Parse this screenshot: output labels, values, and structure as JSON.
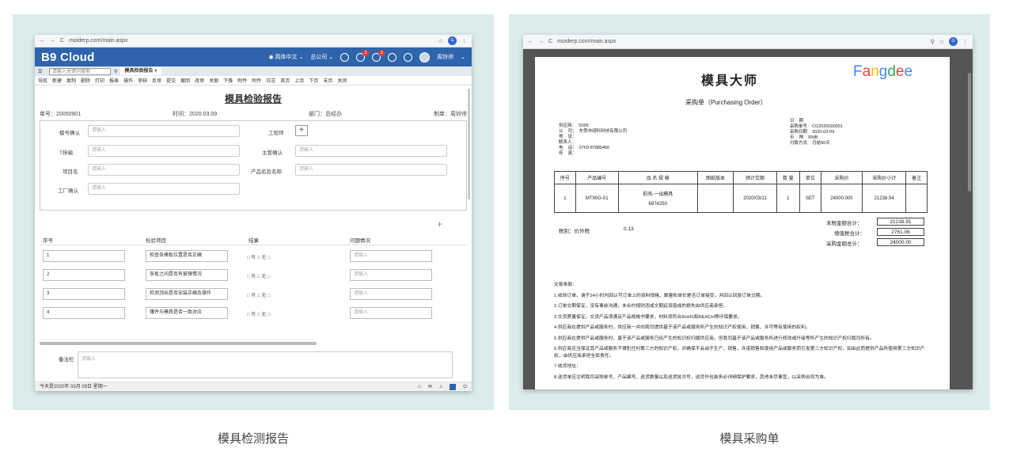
{
  "left": {
    "caption": "模具检测报告",
    "url": "moiderp.com/main.aspx",
    "avatar": "G",
    "logo": "B9 Cloud",
    "header_links": [
      "简体中文",
      "总公司"
    ],
    "user": "周铃帅",
    "badge1": "2",
    "badge2": "3",
    "search_placeholder": "请输入关键词搜索",
    "tab": "模具检验报告",
    "toolbar": [
      "导航",
      "新建",
      "复制",
      "删除",
      "打印",
      "报表",
      "操作",
      "审核",
      "反审",
      "提交",
      "撤回",
      "改审",
      "关联",
      "下推",
      "附件",
      "附件",
      "日志",
      "首页",
      "上页",
      "下页",
      "末页",
      "关闭"
    ],
    "form_title": "模具检验报告",
    "meta": {
      "no": "单号：20050901",
      "date": "时间：2020.03.09",
      "dept": "部门：总经办",
      "maker": "制单：周铃帅"
    },
    "fields": {
      "f1": "模号确认",
      "f2": "工程师",
      "f3": "T排编",
      "f4": "主管确认",
      "f5": "项目名",
      "f6": "产品名及名称",
      "f7": "工厂确认"
    },
    "ph": "请输入",
    "cols": {
      "c1": "序号",
      "c2": "检验项目",
      "c3": "结果",
      "c4": "问题情况"
    },
    "rows": [
      {
        "n": "1",
        "item": "检查各模板位置是否正确",
        "res": "□ 有  □ 无  □"
      },
      {
        "n": "2",
        "item": "各板之间是否有披锋情况",
        "res": "□ 有  □ 无  □"
      },
      {
        "n": "3",
        "item": "检测顶出是否安装正确及操作",
        "res": "□ 有  □ 无  □"
      },
      {
        "n": "4",
        "item": "镶件与模具是否一致对应",
        "res": "□ 有  □ 无  □"
      }
    ],
    "remark_label": "备注栏",
    "status": "今天是2020年 03月 09日 星期一"
  },
  "right": {
    "caption": "模具采购单",
    "url": "moiderp.com/main.aspx",
    "avatar": "G",
    "title": "模具大师",
    "brand": "Fangdee",
    "subtitle": "采购单（Purchasing Order）",
    "supplier": "供应商：  S005\n公    司：  东莞市翊科科技有限公司\n地    址：\n联系人：\n电    话：  0769-87885466\n传    真：",
    "orderinfo": "日    期\n采购单号    CG2020030001\n采购日期    2020-03-09\n币    种    RMB\n付款方式    月结90天",
    "cols": [
      "序号",
      "产品编号",
      "品  名  规  格",
      "图纸版本",
      "预计交期",
      "数 量",
      "单位",
      "采购价",
      "采购价小计",
      "备注"
    ],
    "row": {
      "n": "1",
      "code": "MT90G-01",
      "name": "前壳-一出模具",
      "name2": "6874250",
      "date": "2020/03/11",
      "qty": "1",
      "unit": "SET",
      "price": "24000.000",
      "sub": "21238.94"
    },
    "tax_label": "税别：价外税",
    "tax_rate": "0.13",
    "totals": [
      {
        "l": "未税金额合计：",
        "v": "21238.91"
      },
      {
        "l": "增值税合计：",
        "v": "2761.06"
      },
      {
        "l": "采购金额总计：",
        "v": "24000.00"
      }
    ],
    "terms": [
      "交易条款：",
      "1.收到订单，请于24小时内回认可订单上的资料规格、数量和单价是否订单接受，并回认回复订单交期。",
      "2.订单交期保证，没有事前沟通，未合约规则违或文期延误造成的损失由供应商承担。",
      "3.交货质量保证，交货产品须满足产品规格书要求，材料须符合RoHS和REACH等环保要求。",
      "4.供应商在提供产品或服务时，供应商一并向我司提供基于该产品或服务所产生的知识产权使用、销售、许可等有使用的权利。",
      "5.供应商在提供产品或服务时，基于该产品或服务已经产生的知识权归属供应商，但我司基于该产品或服务所进行修改或升级等所产生的知识产权归我司所有。",
      "6.供应商应当保证其产品或服务不侵犯任何第三方的知识产权，并确保不会由于生产、销售、许诺销售和使用产品或服务而引发第三方知识产权，如由此而提供产品所使用第三方知识产权，由供应商承担全部责任。",
      "7.收货地址：",
      "8.送货单应注明我司采购单号、产品编号、送货数量以及送货批次号，送货外包装务必详细保护要求，其他未尽事宜，以采购合同为准。"
    ]
  }
}
